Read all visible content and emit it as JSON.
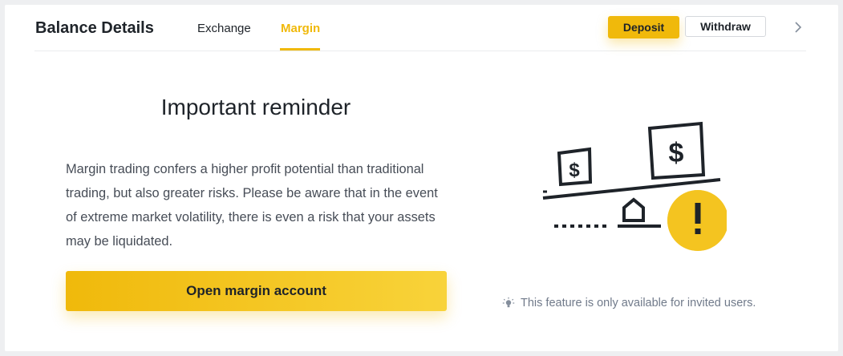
{
  "header": {
    "title": "Balance Details",
    "tabs": [
      {
        "label": "Exchange",
        "active": false
      },
      {
        "label": "Margin",
        "active": true
      }
    ],
    "deposit_label": "Deposit",
    "withdraw_label": "Withdraw",
    "more_icon": "chevron-right-icon"
  },
  "reminder": {
    "title": "Important reminder",
    "body": "Margin trading confers a higher profit potential than traditional trading, but also greater risks. Please be aware that in the event of extreme market volatility, there is even a risk that your assets may be liquidated.",
    "open_button_label": "Open margin account"
  },
  "illustration": {
    "icon": "seesaw-risk-illustration",
    "warning_icon": "exclamation-circle-icon"
  },
  "note": {
    "icon": "lightbulb-icon",
    "text": "This feature is only available for invited users."
  },
  "colors": {
    "accent": "#f0b90b",
    "text_primary": "#1e2329",
    "text_secondary": "#474d57",
    "text_muted": "#707a8a",
    "background": "#eeeff1"
  }
}
